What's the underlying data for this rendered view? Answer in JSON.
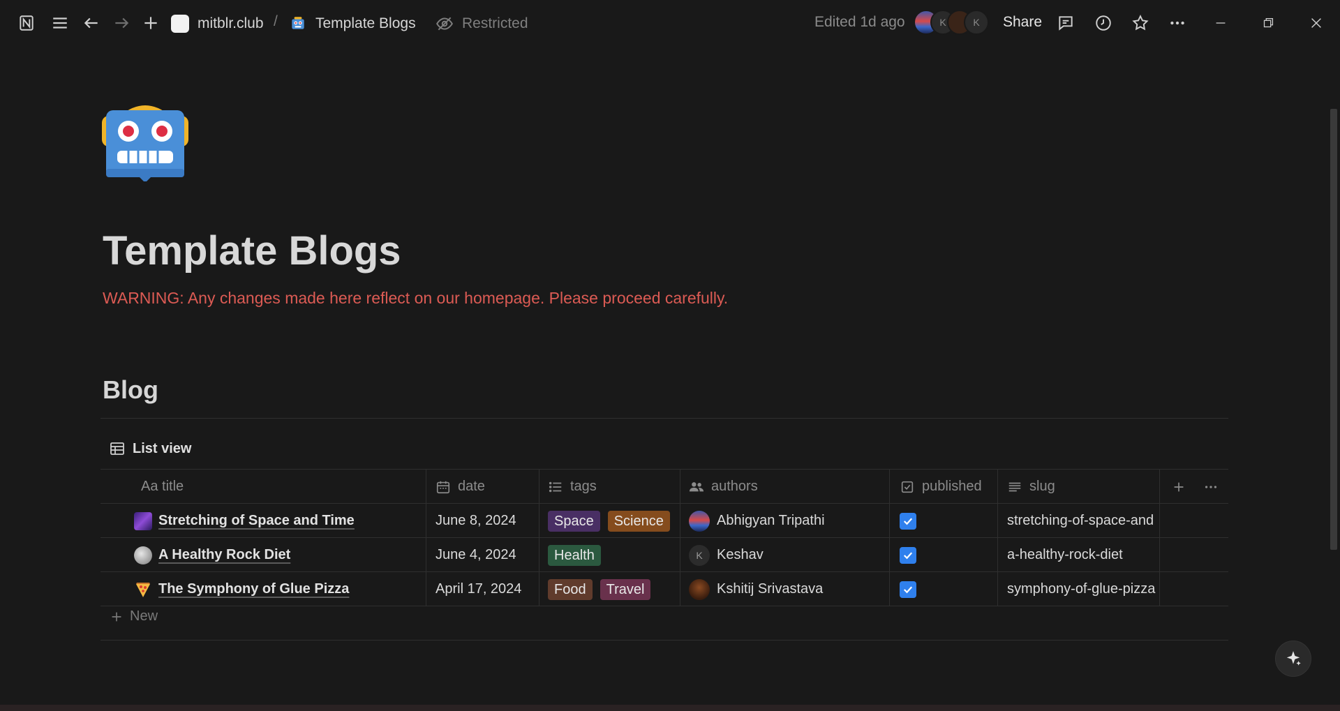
{
  "topbar": {
    "workspace": "mitblr.club",
    "separator": "/",
    "page_crumb": "Template Blogs",
    "restricted": "Restricted",
    "edited": "Edited 1d ago",
    "share": "Share",
    "avatar_letters": [
      "K",
      "K"
    ]
  },
  "page": {
    "title": "Template Blogs",
    "warning_label": "WARNING:",
    "warning_text": " Any changes made here reflect on our homepage. Please proceed carefully.",
    "section_heading": "Blog",
    "view_label": "List view",
    "icon": "robot-emoji"
  },
  "table": {
    "columns": [
      {
        "label": "Aa title",
        "icon": "text-icon"
      },
      {
        "label": "date",
        "icon": "calendar-icon"
      },
      {
        "label": "tags",
        "icon": "list-icon"
      },
      {
        "label": "authors",
        "icon": "people-icon"
      },
      {
        "label": "published",
        "icon": "checkbox-icon"
      },
      {
        "label": "slug",
        "icon": "lines-icon"
      }
    ],
    "rows": [
      {
        "title": "Stretching of Space and Time",
        "emoji": "milky-way",
        "date": "June 8, 2024",
        "tags": [
          {
            "label": "Space",
            "color": "#492f64"
          },
          {
            "label": "Science",
            "color": "#854c1d"
          }
        ],
        "author": "Abhigyan Tripathi",
        "published": true,
        "slug": "stretching-of-space-and"
      },
      {
        "title": "A Healthy Rock Diet",
        "emoji": "rock",
        "date": "June 4, 2024",
        "tags": [
          {
            "label": "Health",
            "color": "#2b593f"
          }
        ],
        "author": "Keshav",
        "author_initial": "K",
        "published": true,
        "slug": "a-healthy-rock-diet"
      },
      {
        "title": "The Symphony of Glue Pizza",
        "emoji": "pizza",
        "date": "April 17, 2024",
        "tags": [
          {
            "label": "Food",
            "color": "#603b2c"
          },
          {
            "label": "Travel",
            "color": "#69314c"
          }
        ],
        "author": "Kshitij Srivastava",
        "published": true,
        "slug": "symphony-of-glue-pizza"
      }
    ],
    "new_label": "New"
  },
  "colors": {
    "background": "#191919",
    "warning": "#dc5b54",
    "checkbox": "#2f80ed"
  }
}
